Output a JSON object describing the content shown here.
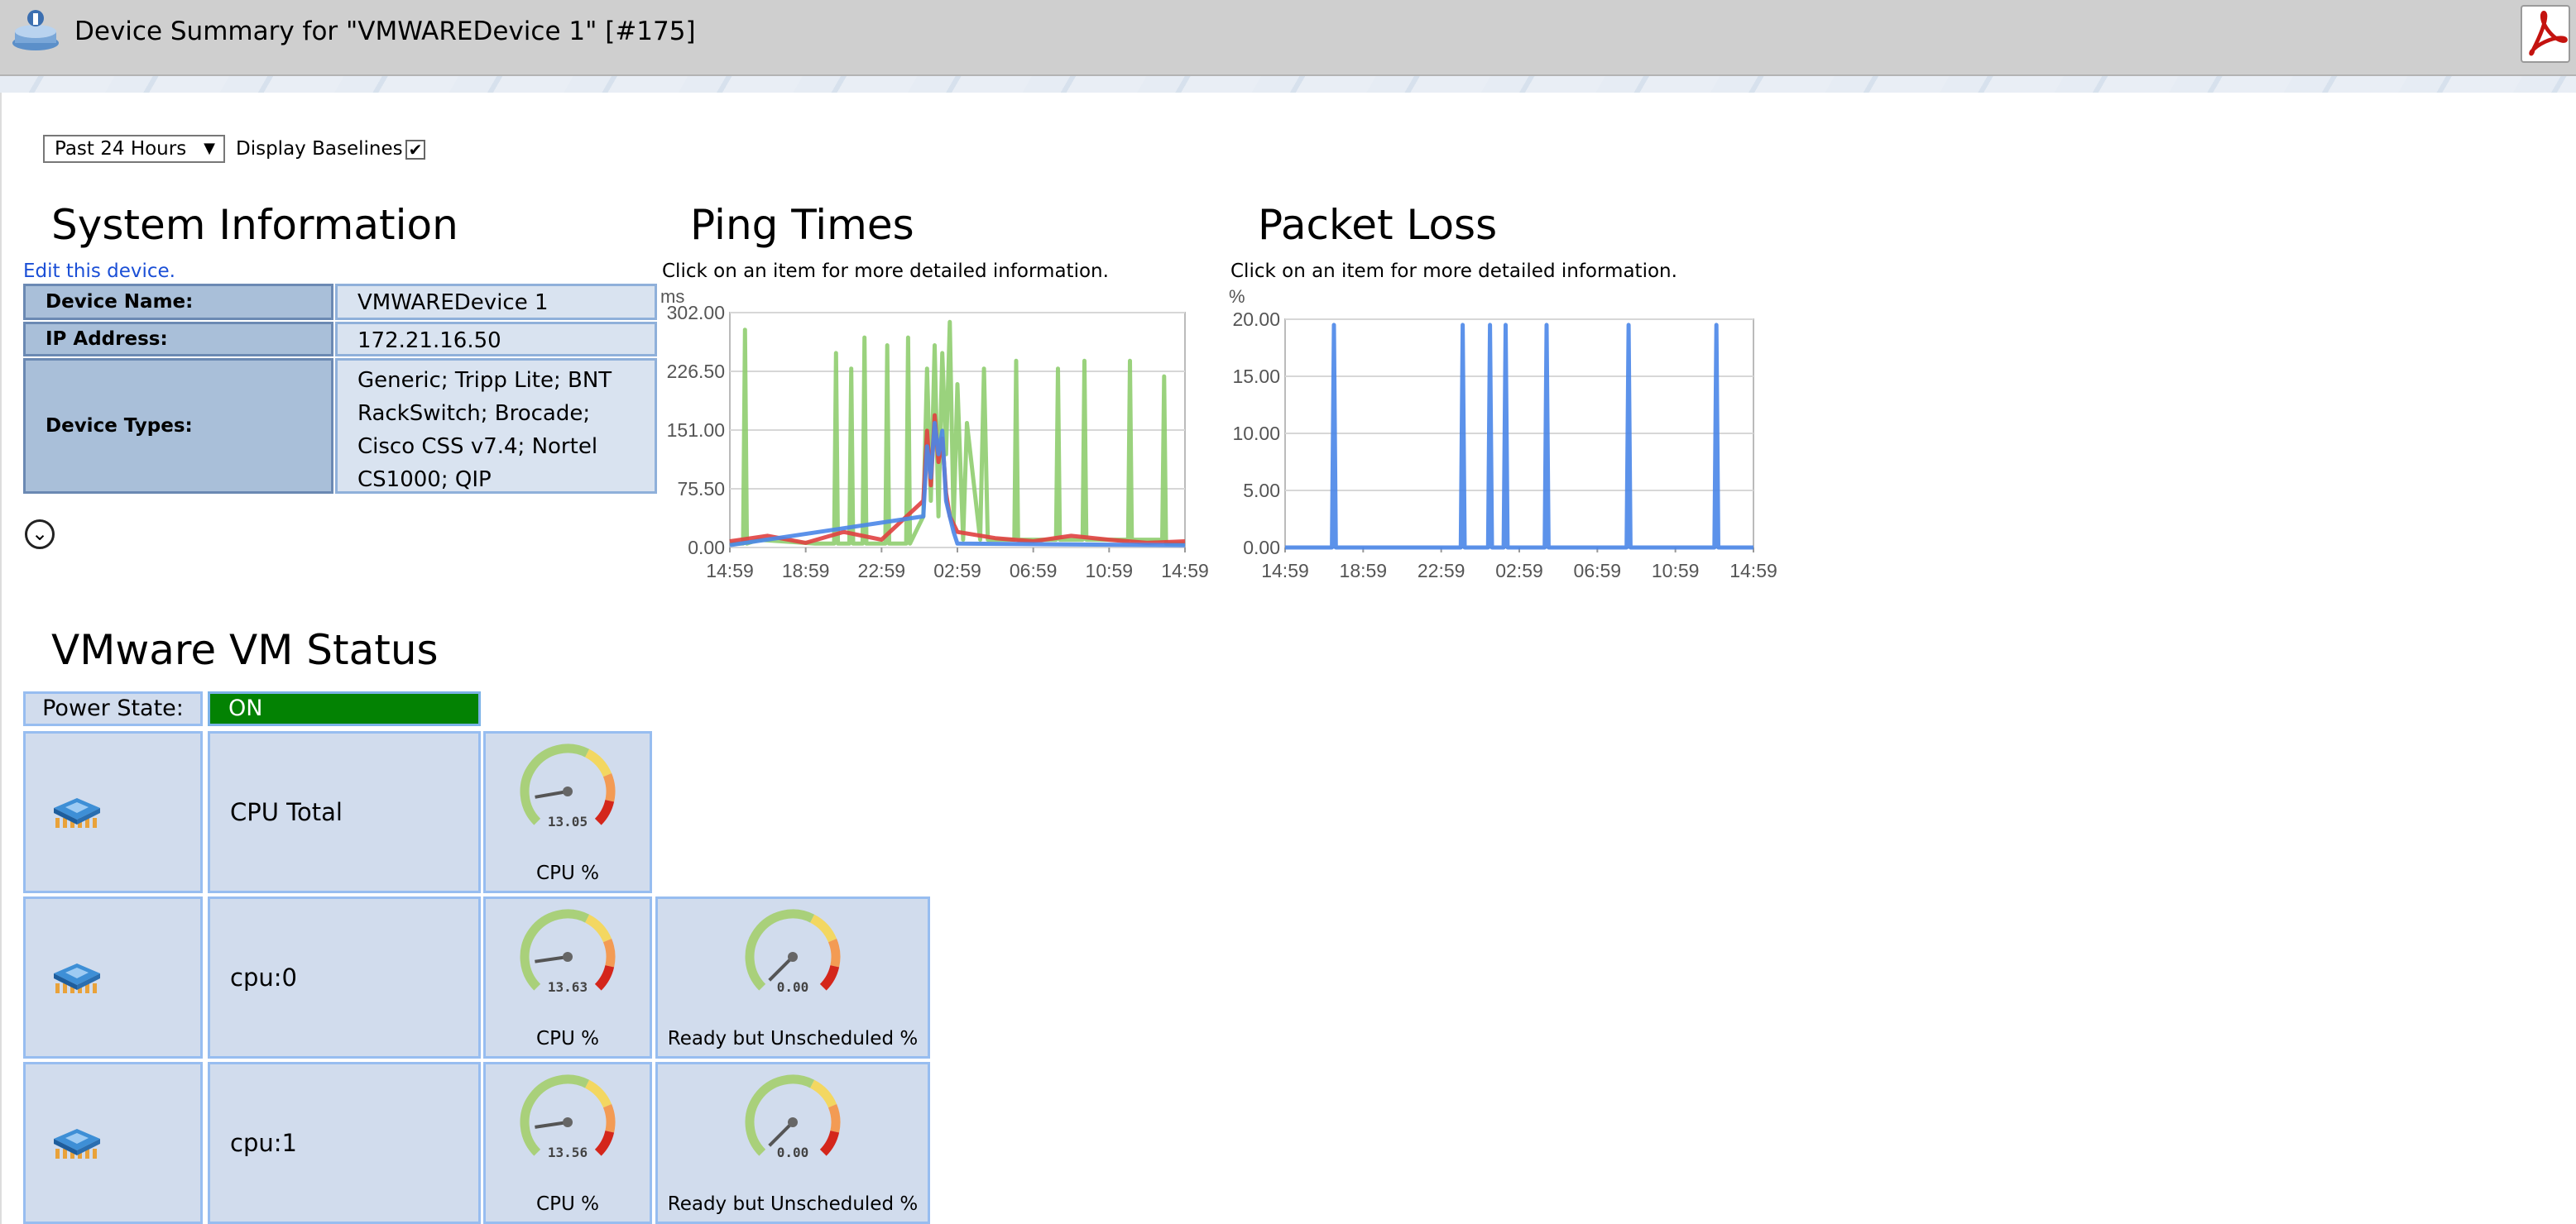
{
  "header": {
    "title": "Device Summary for \"VMWAREDevice 1\" [#175]",
    "app_icon": "device-summary-icon",
    "pdf_icon": "pdf-icon"
  },
  "controls": {
    "time_range": "Past 24 Hours",
    "display_baselines_label": "Display Baselines",
    "display_baselines_checked": true
  },
  "system_info": {
    "title": "System Information",
    "edit_link": "Edit this device.",
    "rows": [
      {
        "key": "Device Name:",
        "value": "VMWAREDevice 1"
      },
      {
        "key": "IP Address:",
        "value": "172.21.16.50"
      },
      {
        "key": "Device Types:",
        "value": "Generic; Tripp Lite; BNT RackSwitch; Brocade; Cisco CSS v7.4; Nortel CS1000; QIP"
      }
    ]
  },
  "ping": {
    "title": "Ping Times",
    "subtitle": "Click on an item for more detailed information."
  },
  "loss": {
    "title": "Packet Loss",
    "subtitle": "Click on an item for more detailed information."
  },
  "chart_data": [
    {
      "type": "line",
      "title": "",
      "ylabel": "ms",
      "ylim": [
        0,
        302
      ],
      "yticks": [
        "302.00",
        "226.50",
        "151.00",
        "75.50",
        "0.00"
      ],
      "xticks": [
        "14:59",
        "18:59",
        "22:59",
        "02:59",
        "06:59",
        "10:59",
        "14:59"
      ],
      "grid": true,
      "series": [
        {
          "color": "#8fcd6f",
          "x_hours": [
            0,
            0.7,
            0.8,
            0.9,
            1.5,
            4.5,
            5.5,
            5.6,
            5.7,
            6.3,
            6.4,
            6.5,
            7,
            7.1,
            7.2,
            8.2,
            8.3,
            8.4,
            9.3,
            9.4,
            9.5,
            10.2,
            10.4,
            10.6,
            10.8,
            11,
            11.2,
            11.4,
            11.6,
            11.8,
            12.0,
            12.3,
            12.5,
            13.2,
            13.4,
            13.6,
            15.0,
            15.1,
            15.2,
            17.2,
            17.3,
            17.4,
            18.6,
            18.7,
            18.8,
            21.0,
            21.1,
            21.2,
            22.8,
            22.9,
            23.0,
            24
          ],
          "values": [
            5,
            5,
            280,
            5,
            10,
            5,
            5,
            250,
            5,
            5,
            230,
            5,
            5,
            270,
            5,
            5,
            260,
            5,
            5,
            270,
            5,
            40,
            230,
            60,
            260,
            40,
            250,
            120,
            290,
            30,
            210,
            10,
            160,
            10,
            230,
            10,
            10,
            240,
            10,
            10,
            230,
            10,
            10,
            240,
            10,
            10,
            240,
            10,
            10,
            220,
            5,
            5
          ]
        },
        {
          "color": "#e04040",
          "x_hours": [
            0,
            2,
            4,
            6,
            8,
            10.2,
            10.4,
            10.6,
            10.8,
            11.0,
            11.2,
            11.4,
            11.6,
            12,
            14,
            16,
            18,
            20,
            22,
            24
          ],
          "values": [
            8,
            15,
            6,
            20,
            10,
            60,
            150,
            80,
            170,
            110,
            140,
            70,
            40,
            20,
            12,
            8,
            15,
            10,
            6,
            8
          ]
        },
        {
          "color": "#4a86e8",
          "x_hours": [
            0,
            10.2,
            10.4,
            10.6,
            10.8,
            11.0,
            11.2,
            11.4,
            11.6,
            11.8,
            12,
            24
          ],
          "values": [
            3,
            40,
            130,
            90,
            160,
            120,
            150,
            60,
            40,
            20,
            5,
            3
          ]
        }
      ]
    },
    {
      "type": "line",
      "title": "",
      "ylabel": "%",
      "ylim": [
        0,
        20
      ],
      "yticks": [
        "20.00",
        "15.00",
        "10.00",
        "5.00",
        "0.00"
      ],
      "xticks": [
        "14:59",
        "18:59",
        "22:59",
        "02:59",
        "06:59",
        "10:59",
        "14:59"
      ],
      "grid": true,
      "series": [
        {
          "color": "#4a86e8",
          "x_hours": [
            0,
            2.4,
            2.5,
            2.6,
            9.0,
            9.1,
            9.2,
            10.4,
            10.5,
            10.6,
            11.2,
            11.3,
            11.4,
            13.3,
            13.4,
            13.5,
            17.5,
            17.6,
            17.7,
            22.0,
            22.1,
            22.2,
            24
          ],
          "values": [
            0,
            0,
            19.5,
            0,
            0,
            19.5,
            0,
            0,
            19.5,
            0,
            0,
            19.5,
            0,
            0,
            19.5,
            0,
            0,
            19.5,
            0,
            0,
            19.5,
            0,
            0
          ]
        }
      ]
    }
  ],
  "vm": {
    "title": "VMware VM Status",
    "power_label": "Power State:",
    "power_value": "ON",
    "power_color": "#038203",
    "rows": [
      {
        "name": "CPU Total",
        "icon": "cpu-chip-icon",
        "gauges": [
          {
            "value": "13.05",
            "fraction": 0.1305,
            "caption": "CPU %"
          }
        ]
      },
      {
        "name": "cpu:0",
        "icon": "cpu-chip-icon",
        "gauges": [
          {
            "value": "13.63",
            "fraction": 0.1363,
            "caption": "CPU %"
          },
          {
            "value": "0.00",
            "fraction": 0,
            "caption": "Ready but Unscheduled %"
          }
        ]
      },
      {
        "name": "cpu:1",
        "icon": "cpu-chip-icon",
        "gauges": [
          {
            "value": "13.56",
            "fraction": 0.1356,
            "caption": "CPU %"
          },
          {
            "value": "0.00",
            "fraction": 0,
            "caption": "Ready but Unscheduled %"
          }
        ]
      }
    ]
  }
}
